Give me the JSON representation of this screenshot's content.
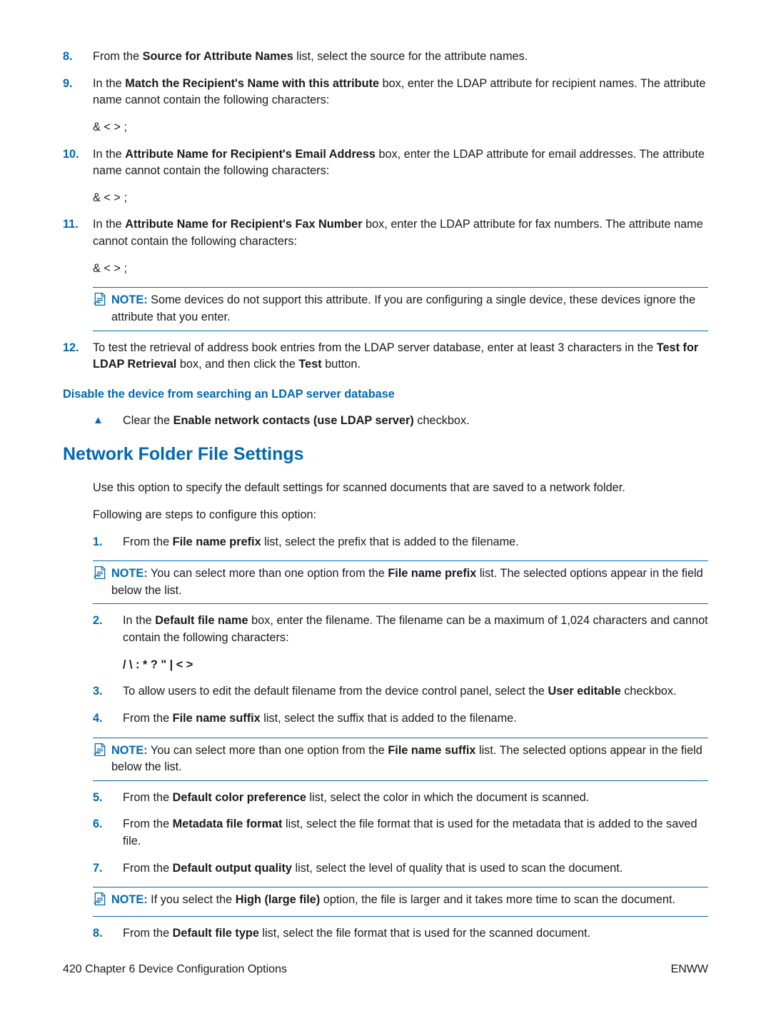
{
  "s8": {
    "n": "8.",
    "a": "From the ",
    "b": "Source for Attribute Names",
    "c": " list, select the source for the attribute names."
  },
  "s9": {
    "n": "9.",
    "a": "In the ",
    "b": "Match the Recipient's Name with this attribute",
    "c": " box, enter the LDAP attribute for recipient names. The attribute name cannot contain the following characters:"
  },
  "chars": "& < > ;",
  "s10": {
    "n": "10.",
    "a": "In the ",
    "b": "Attribute Name for Recipient's Email Address",
    "c": " box, enter the LDAP attribute for email addresses. The attribute name cannot contain the following characters:"
  },
  "s11": {
    "n": "11.",
    "a": "In the ",
    "b": "Attribute Name for Recipient's Fax Number",
    "c": " box, enter the LDAP attribute for fax numbers. The attribute name cannot contain the following characters:"
  },
  "note1": {
    "l": "NOTE:",
    "t": "   Some devices do not support this attribute. If you are configuring a single device, these devices ignore the attribute that you enter."
  },
  "s12": {
    "n": "12.",
    "a": "To test the retrieval of address book entries from the LDAP server database, enter at least 3 characters in the ",
    "b": "Test for LDAP Retrieval",
    "c": " box, and then click the ",
    "d": "Test",
    "e": " button."
  },
  "h4": "Disable the device from searching an LDAP server database",
  "tri": {
    "sym": "▲",
    "a": "Clear the ",
    "b": "Enable network contacts (use LDAP server)",
    "c": " checkbox."
  },
  "h2": "Network Folder File Settings",
  "p1": "Use this option to specify the default settings for scanned documents that are saved to a network folder.",
  "p2": "Following are steps to configure this option:",
  "t1": {
    "n": "1.",
    "a": "From the ",
    "b": "File name prefix",
    "c": " list, select the prefix that is added to the filename."
  },
  "n2": {
    "l": "NOTE:",
    "a": "   You can select more than one option from the ",
    "b": "File name prefix",
    "c": " list. The selected options appear in the field below the list."
  },
  "t2": {
    "n": "2.",
    "a": "In the ",
    "b": "Default file name",
    "c": " box, enter the filename. The filename can be a maximum of 1,024 characters and cannot contain the following characters:"
  },
  "chars2": "/ \\ : * ? \" | < >",
  "t3": {
    "n": "3.",
    "a": "To allow users to edit the default filename from the device control panel, select the ",
    "b": "User editable",
    "c": " checkbox."
  },
  "t4": {
    "n": "4.",
    "a": "From the ",
    "b": "File name suffix",
    "c": " list, select the suffix that is added to the filename."
  },
  "n3": {
    "l": "NOTE:",
    "a": "   You can select more than one option from the ",
    "b": "File name suffix",
    "c": " list. The selected options appear in the field below the list."
  },
  "t5": {
    "n": "5.",
    "a": "From the ",
    "b": "Default color preference",
    "c": " list, select the color in which the document is scanned."
  },
  "t6": {
    "n": "6.",
    "a": "From the ",
    "b": "Metadata file format",
    "c": " list, select the file format that is used for the metadata that is added to the saved file."
  },
  "t7": {
    "n": "7.",
    "a": "From the ",
    "b": "Default output quality",
    "c": " list, select the level of quality that is used to scan the document."
  },
  "n4": {
    "l": "NOTE:",
    "a": "   If you select the ",
    "b": "High (large file)",
    "c": " option, the file is larger and it takes more time to scan the document."
  },
  "t8": {
    "n": "8.",
    "a": "From the ",
    "b": "Default file type",
    "c": " list, select the file format that is used for the scanned document."
  },
  "footer": {
    "left": "420   Chapter 6   Device Configuration Options",
    "right": "ENWW"
  }
}
